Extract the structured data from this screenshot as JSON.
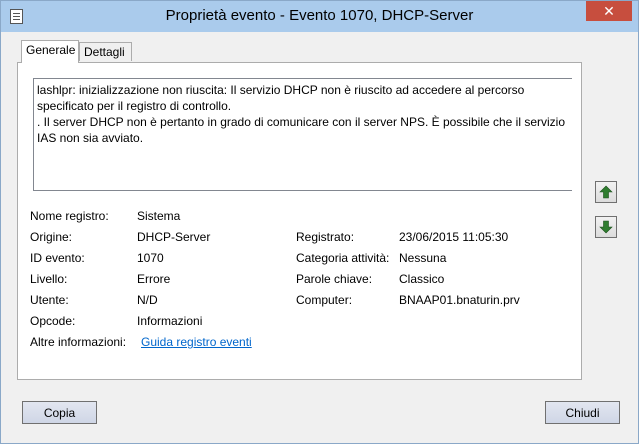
{
  "window": {
    "title": "Proprietà evento - Evento 1070, DHCP-Server",
    "close_glyph": "✕"
  },
  "tabs": [
    {
      "label": "Generale",
      "active": true
    },
    {
      "label": "Dettagli",
      "active": false
    }
  ],
  "description": "lashlpr: inizializzazione non riuscita: Il servizio DHCP non è riuscito ad accedere al percorso\nspecificato per il registro di controllo.\n. Il server DHCP non è pertanto in grado di comunicare con il server NPS. È possibile che il servizio\nIAS non sia avviato.",
  "fields": {
    "log_name": {
      "label": "Nome registro:",
      "value": "Sistema"
    },
    "source": {
      "label": "Origine:",
      "value": "DHCP-Server"
    },
    "event_id": {
      "label": "ID evento:",
      "value": "1070"
    },
    "level": {
      "label": "Livello:",
      "value": "Errore"
    },
    "user": {
      "label": "Utente:",
      "value": "N/D"
    },
    "opcode": {
      "label": "Opcode:",
      "value": "Informazioni"
    },
    "more_info": {
      "label": "Altre informazioni:",
      "value": "Guida registro eventi"
    },
    "logged": {
      "label": "Registrato:",
      "value": "23/06/2015 11:05:30"
    },
    "task_category": {
      "label": "Categoria attività:",
      "value": "Nessuna"
    },
    "keywords": {
      "label": "Parole chiave:",
      "value": "Classico"
    },
    "computer": {
      "label": "Computer:",
      "value": "BNAAP01.bnaturin.prv"
    }
  },
  "buttons": {
    "copy": "Copia",
    "close": "Chiudi"
  },
  "colors": {
    "titlebar": "#aacbec",
    "close_button": "#c74e3e",
    "link": "#0066cc",
    "arrow": "#2f7d2f"
  }
}
